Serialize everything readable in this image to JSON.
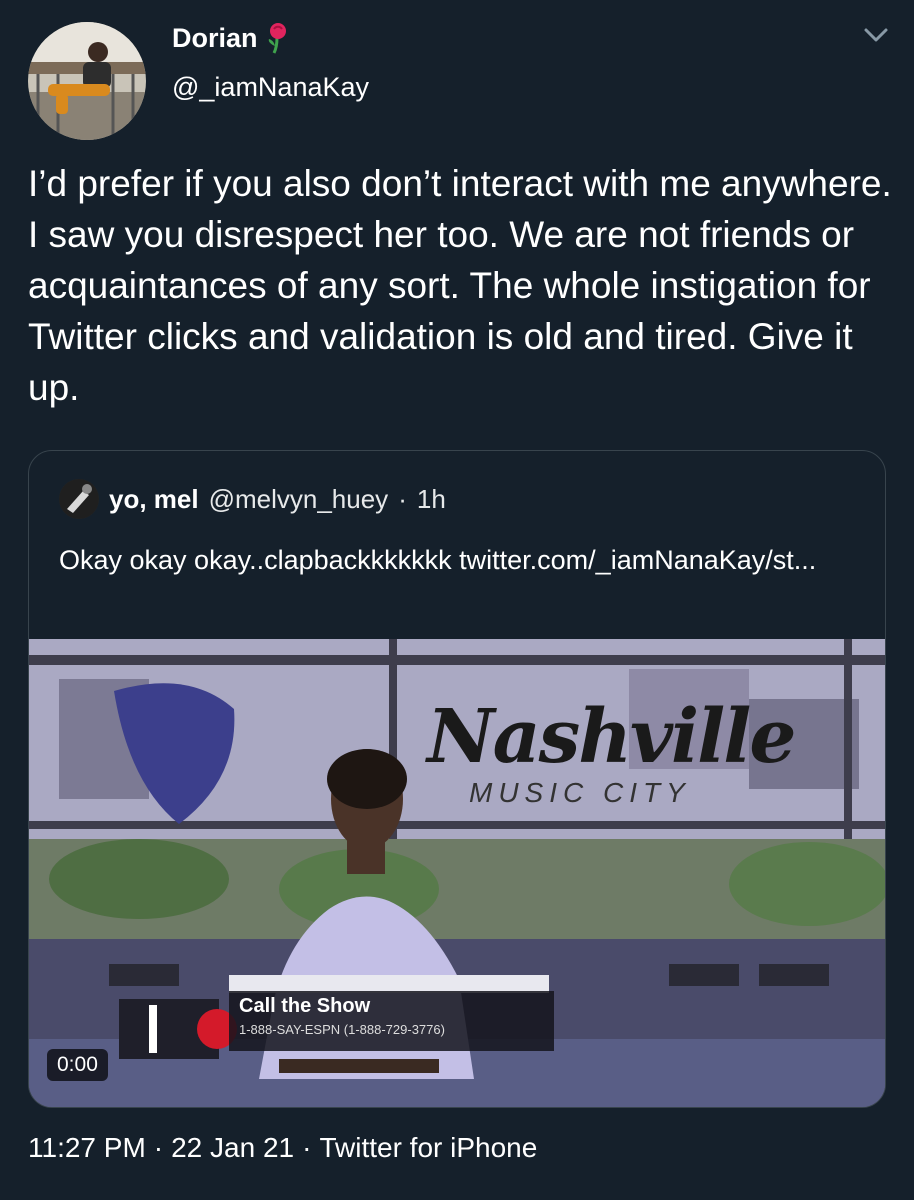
{
  "tweet": {
    "display_name": "Dorian",
    "handle": "@_iamNanaKay",
    "text": "I’d prefer if you also don’t interact with me anywhere. I saw you disrespect her too. We are not friends or acquaintances of any sort. The whole instigation for Twitter clicks and validation is old and tired. Give it up.",
    "time": "11:27 PM",
    "date": "22 Jan 21",
    "source": "Twitter for iPhone",
    "separator": "·"
  },
  "quote": {
    "display_name": "yo, mel",
    "handle": "@melvyn_huey",
    "separator": "·",
    "time": "1h",
    "text": "Okay okay okay..clapbackkkkkkk twitter.com/_iamNanaKay/st...",
    "media": {
      "duration": "0:00",
      "logo_text": "Nashville",
      "logo_sub": "MUSIC CITY",
      "lower_third_title": "Call the Show",
      "lower_third_phone": "1-888-SAY-ESPN (1-888-729-3776)"
    }
  },
  "colors": {
    "background": "#15202b",
    "border": "#38444d",
    "text": "#ffffff"
  },
  "icons": {
    "menu": "chevron-down-icon",
    "emoji": "rose-icon"
  }
}
